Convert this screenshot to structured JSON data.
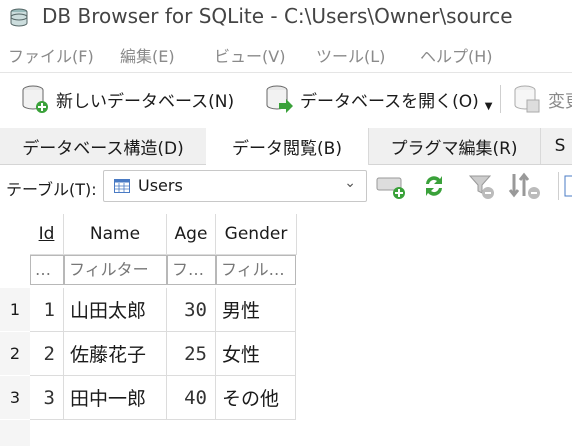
{
  "window": {
    "title": "DB Browser for SQLite - C:\\Users\\Owner\\source"
  },
  "menu": [
    {
      "label": "ファイル(F)"
    },
    {
      "label": "編集(E)"
    },
    {
      "label": "ビュー(V)"
    },
    {
      "label": "ツール(L)"
    },
    {
      "label": "ヘルプ(H)"
    }
  ],
  "toolbar": {
    "new_db": "新しいデータベース(N)",
    "open_db": "データベースを開く(O)",
    "changes": "変更"
  },
  "tabs": [
    {
      "label": "データベース構造(D)"
    },
    {
      "label": "データ閲覧(B)"
    },
    {
      "label": "プラグマ編集(R)"
    },
    {
      "label": "S"
    }
  ],
  "table_bar": {
    "label": "テーブル(T):",
    "selected": "Users"
  },
  "grid": {
    "columns": [
      "Id",
      "Name",
      "Age",
      "Gender"
    ],
    "filters": [
      "…",
      "フィルター",
      "フ…",
      "フィル…"
    ],
    "rows": [
      {
        "num": "1",
        "id": "1",
        "name": "山田太郎",
        "age": "30",
        "gender": "男性"
      },
      {
        "num": "2",
        "id": "2",
        "name": "佐藤花子",
        "age": "25",
        "gender": "女性"
      },
      {
        "num": "3",
        "id": "3",
        "name": "田中一郎",
        "age": "40",
        "gender": "その他"
      }
    ]
  }
}
